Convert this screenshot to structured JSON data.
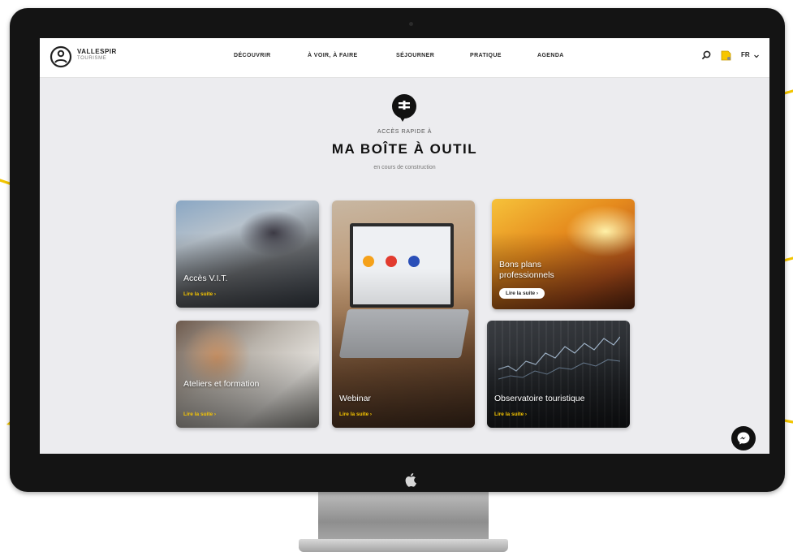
{
  "brand": {
    "name": "VALLESPIR",
    "tagline": "TOURISME"
  },
  "nav": {
    "items": [
      "DÉCOUVRIR",
      "À VOIR, À FAIRE",
      "SÉJOURNER",
      "PRATIQUE",
      "AGENDA"
    ],
    "language": "FR"
  },
  "hero": {
    "kicker": "ACCÈS RAPIDE À",
    "title": "MA BOÎTE À OUTIL",
    "subtitle": "en cours de construction"
  },
  "cards": [
    {
      "title": "Accès V.I.T.",
      "link": "Lire la suite"
    },
    {
      "title": "Webinar",
      "link": "Lire la suite"
    },
    {
      "title": "Bons plans professionnels",
      "link": "Lire la suite"
    },
    {
      "title": "Ateliers et formation",
      "link": "Lire la suite"
    },
    {
      "title": "Observatoire touristique",
      "link": "Lire la suite"
    }
  ],
  "colors": {
    "accent": "#f7c600",
    "bezel": "#141414",
    "screen_bg": "#ececef"
  },
  "icons": [
    "logo-mark-icon",
    "search-icon",
    "badge-icon",
    "chevron-down-icon",
    "toolbox-icon",
    "messenger-icon",
    "apple-icon"
  ]
}
